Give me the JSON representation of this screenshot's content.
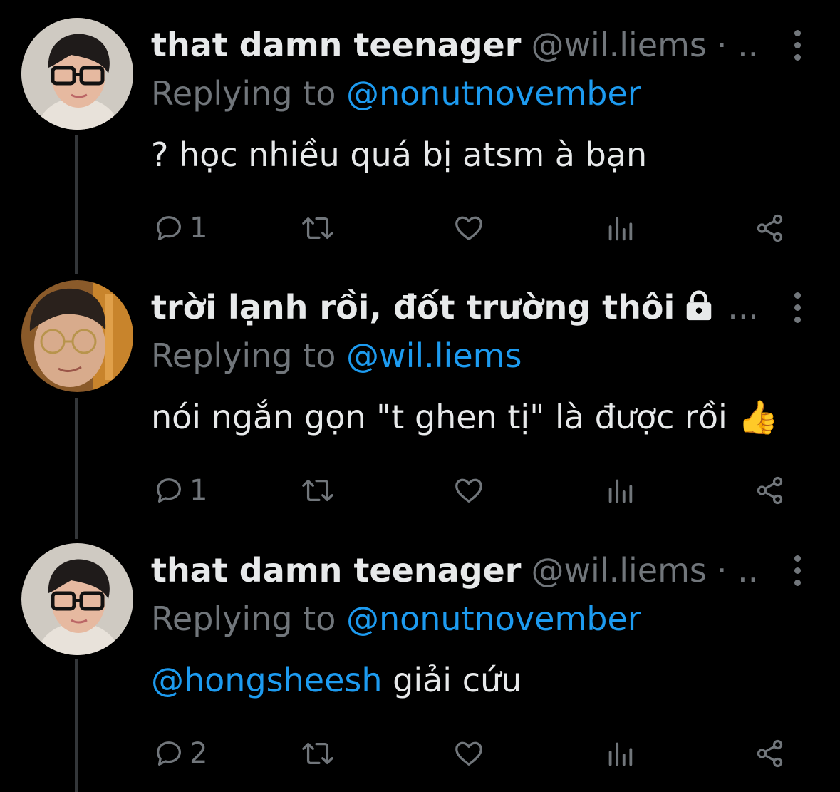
{
  "tweets": [
    {
      "name": "that damn teenager",
      "handle": "@wil.liems",
      "overflow": "· ...",
      "replying_prefix": "Replying to",
      "replying_to": "@nonutnovember",
      "body": "? học nhiều quá bị atsm à bạn",
      "reply_count": "1",
      "avatar": "avatar-glasses-black"
    },
    {
      "name": "trời lạnh rồi, đốt trường thôi",
      "handle": "",
      "overflow": "...",
      "locked": true,
      "replying_prefix": "Replying to",
      "replying_to": "@wil.liems",
      "body": "nói ngắn gọn \"t ghen tị\" là được rồi",
      "body_emoji": "👍",
      "reply_count": "1",
      "avatar": "avatar-glasses-gold"
    },
    {
      "name": "that damn teenager",
      "handle": "@wil.liems",
      "overflow": "· ...",
      "replying_prefix": "Replying to",
      "replying_to": "@nonutnovember",
      "body_mention": "@hongsheesh",
      "body": " giải cứu",
      "reply_count": "2",
      "avatar": "avatar-glasses-black"
    }
  ],
  "colors": {
    "background": "#000000",
    "text": "#e7e9ea",
    "muted": "#71767b",
    "link": "#1d9bf0",
    "thread": "#333639"
  },
  "icons": [
    "reply-icon",
    "retweet-icon",
    "like-icon",
    "views-icon",
    "share-icon",
    "more-icon",
    "lock-icon"
  ]
}
